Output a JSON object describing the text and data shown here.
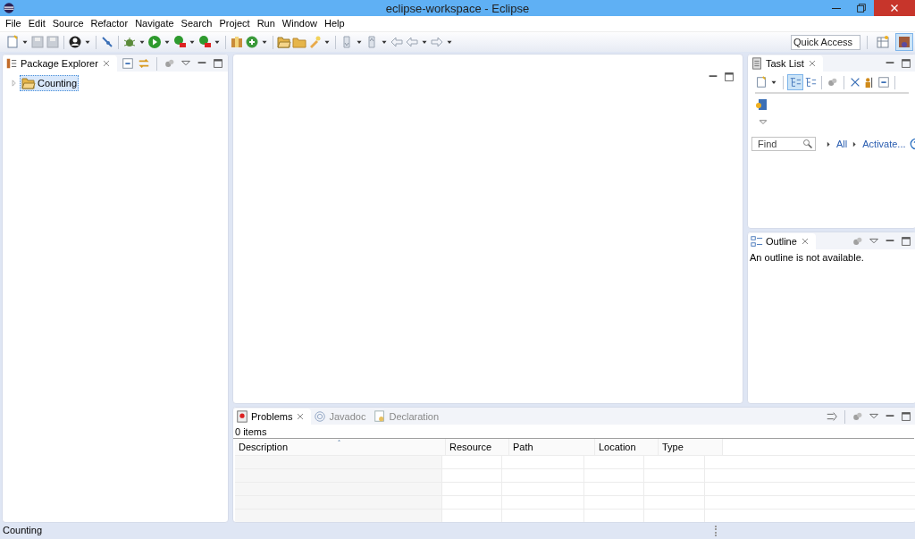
{
  "window": {
    "title": "eclipse-workspace - Eclipse"
  },
  "menu": [
    "File",
    "Edit",
    "Source",
    "Refactor",
    "Navigate",
    "Search",
    "Project",
    "Run",
    "Window",
    "Help"
  ],
  "quick_access": {
    "placeholder": "Quick Access"
  },
  "perspective_buttons": [
    {
      "selected": false
    },
    {
      "selected": true
    }
  ],
  "package_explorer": {
    "title": "Package Explorer",
    "tree": [
      {
        "label": "Counting",
        "expanded": false,
        "selected": true
      }
    ]
  },
  "task_list": {
    "title": "Task List",
    "find": {
      "placeholder": "Find"
    },
    "links": [
      "All",
      "Activate..."
    ]
  },
  "outline": {
    "title": "Outline",
    "message": "An outline is not available."
  },
  "bottom_panel": {
    "tabs": [
      {
        "label": "Problems",
        "selected": true
      },
      {
        "label": "Javadoc",
        "selected": false
      },
      {
        "label": "Declaration",
        "selected": false
      }
    ],
    "count": "0 items",
    "columns": [
      {
        "label": "Description",
        "sorted": true
      },
      {
        "label": "Resource",
        "sorted": false
      },
      {
        "label": "Path",
        "sorted": false
      },
      {
        "label": "Location",
        "sorted": false
      },
      {
        "label": "Type",
        "sorted": false
      }
    ]
  },
  "status_bar": {
    "text": "Counting"
  }
}
